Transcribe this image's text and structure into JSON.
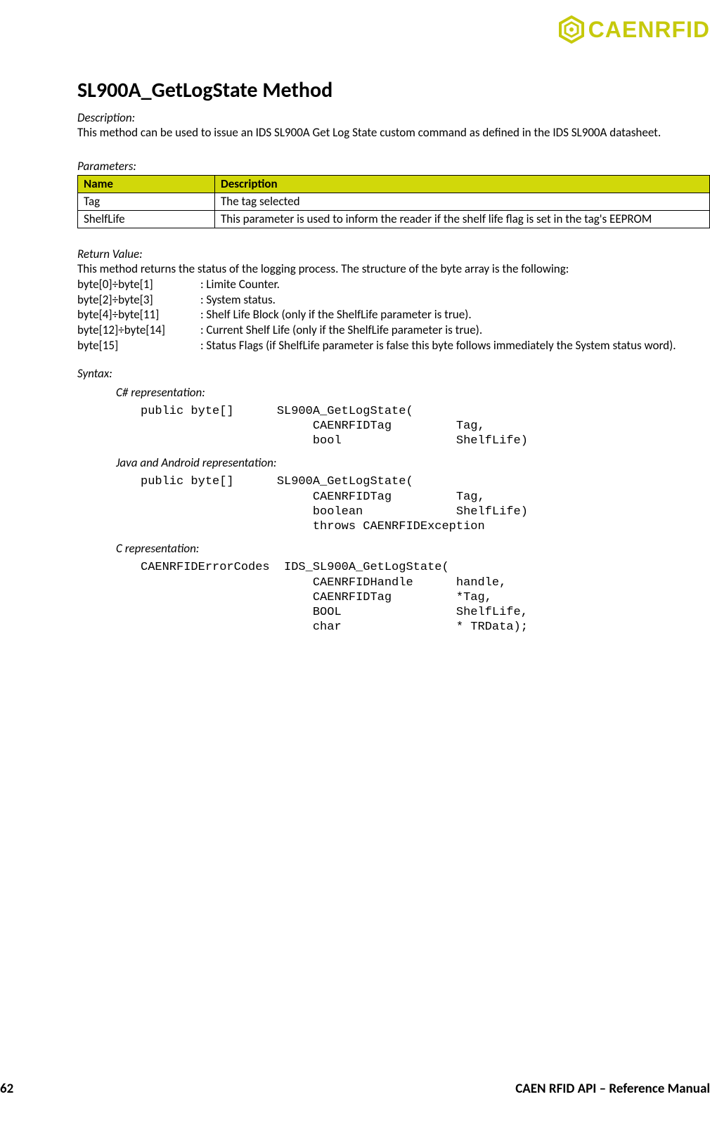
{
  "brand": {
    "name": "CAENRFID"
  },
  "title": "SL900A_GetLogState Method",
  "description": {
    "label": "Description:",
    "text": "This method can be used to issue an IDS SL900A Get Log State custom command as defined in the IDS SL900A datasheet."
  },
  "parameters": {
    "label": "Parameters:",
    "headers": {
      "name": "Name",
      "desc": "Description"
    },
    "rows": [
      {
        "name": "Tag",
        "desc": "The tag selected"
      },
      {
        "name": "ShelfLife",
        "desc": "This parameter is used to inform the reader if the shelf life flag is set in the tag's EEPROM"
      }
    ]
  },
  "returnValue": {
    "label": "Return Value:",
    "intro": "This method returns the status of the logging process. The structure of the byte array is the following:",
    "lines": [
      {
        "k": "byte[0]÷byte[1]",
        "v": ": Limite Counter."
      },
      {
        "k": "byte[2]÷byte[3]",
        "v": ": System status."
      },
      {
        "k": "byte[4]÷byte[11]",
        "v": ": Shelf Life Block (only if the ShelfLife parameter is true)."
      },
      {
        "k": "byte[12]÷byte[14]",
        "v": ": Current Shelf Life (only if the ShelfLife parameter is true)."
      },
      {
        "k": "byte[15]",
        "v": ": Status Flags (if ShelfLife parameter is false this byte follows immediately the System status word)."
      }
    ]
  },
  "syntax": {
    "label": "Syntax:",
    "reps": [
      {
        "label": "C# representation:",
        "code": "public byte[]      SL900A_GetLogState(\n                        CAENRFIDTag         Tag,\n                        bool                ShelfLife)"
      },
      {
        "label": "Java and Android representation:",
        "code": "public byte[]      SL900A_GetLogState(\n                        CAENRFIDTag         Tag,\n                        boolean             ShelfLife)\n                        throws CAENRFIDException"
      },
      {
        "label": "C representation:",
        "code": "CAENRFIDErrorCodes  IDS_SL900A_GetLogState(\n                        CAENRFIDHandle      handle,\n                        CAENRFIDTag         *Tag,\n                        BOOL                ShelfLife,\n                        char                * TRData);"
      }
    ]
  },
  "footer": {
    "page": "62",
    "title": "CAEN RFID API – Reference Manual"
  }
}
